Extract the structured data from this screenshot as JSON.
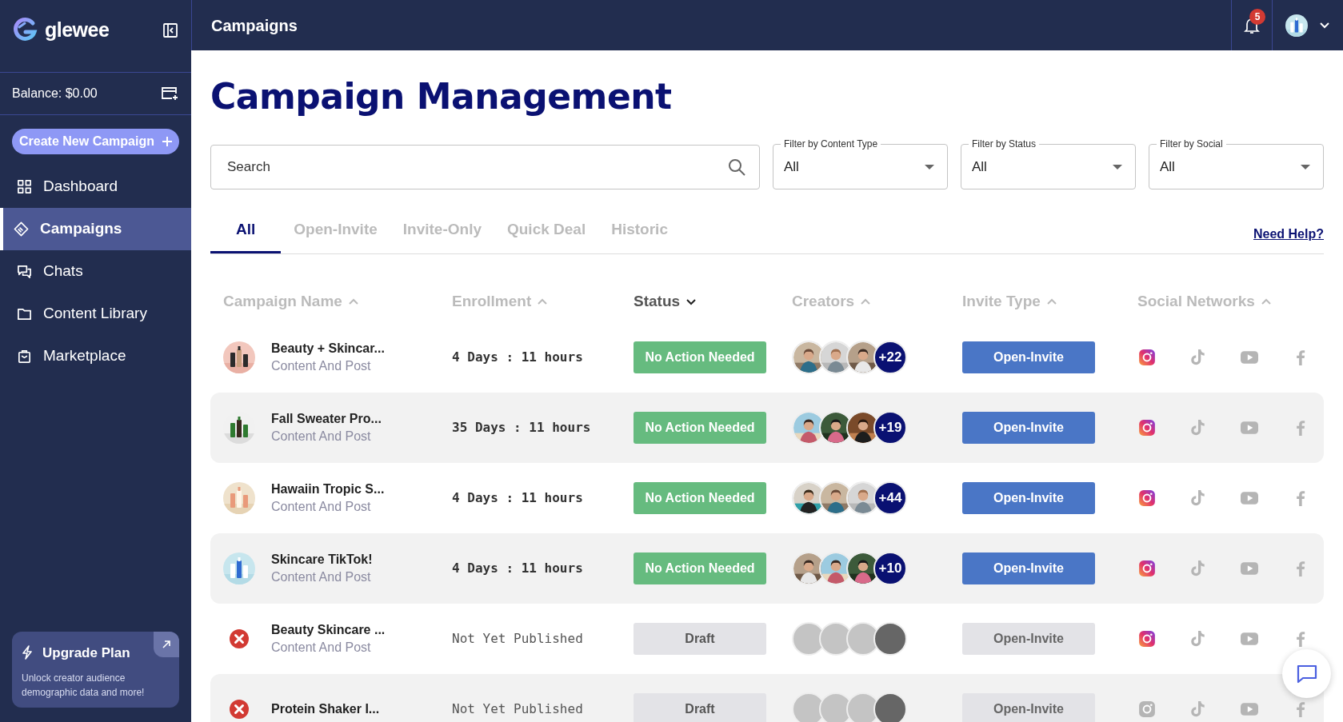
{
  "sidebar": {
    "logo": "glewee",
    "balance": "Balance: $0.00",
    "create_button": "Create New Campaign",
    "items": [
      {
        "label": "Dashboard",
        "selected": false
      },
      {
        "label": "Campaigns",
        "selected": true
      },
      {
        "label": "Chats",
        "selected": false
      },
      {
        "label": "Content Library",
        "selected": false
      },
      {
        "label": "Marketplace",
        "selected": false
      }
    ],
    "upgrade": {
      "title": "Upgrade Plan",
      "text": "Unlock creator audience demographic data and more!"
    }
  },
  "topbar": {
    "title": "Campaigns",
    "notifications": "5"
  },
  "page_title": "Campaign Management",
  "search": {
    "placeholder": "Search"
  },
  "filters": [
    {
      "label": "Filter by Content Type",
      "value": "All"
    },
    {
      "label": "Filter by Status",
      "value": "All"
    },
    {
      "label": "Filter by Social",
      "value": "All"
    }
  ],
  "tabs": [
    {
      "label": "All",
      "selected": true
    },
    {
      "label": "Open-Invite",
      "selected": false
    },
    {
      "label": "Invite-Only",
      "selected": false
    },
    {
      "label": "Quick Deal",
      "selected": false
    },
    {
      "label": "Historic",
      "selected": false
    }
  ],
  "help_link": "Need Help?",
  "columns": [
    {
      "label": "Campaign Name",
      "descending": false,
      "active": false
    },
    {
      "label": "Enrollment",
      "descending": false,
      "active": false
    },
    {
      "label": "Status",
      "descending": true,
      "active": true
    },
    {
      "label": "Creators",
      "descending": false,
      "active": false
    },
    {
      "label": "Invite Type",
      "descending": false,
      "active": false
    },
    {
      "label": "Social Networks",
      "descending": false,
      "active": false
    }
  ],
  "rows": [
    {
      "error": false,
      "name": "Beauty + Skincar...",
      "type": "Content And Post",
      "enrollment": "4 Days : 11 hours",
      "status": {
        "label": "No Action Needed",
        "kind": "ok"
      },
      "creators": {
        "kind": "avatars",
        "count": "+22"
      },
      "invite": {
        "label": "Open-Invite",
        "disabled": false
      },
      "socials": [
        {
          "active": true
        },
        {
          "active": false
        },
        {
          "active": false
        },
        {
          "active": false
        }
      ]
    },
    {
      "error": false,
      "name": "Fall Sweater Pro...",
      "type": "Content And Post",
      "enrollment": "35 Days : 11 hours",
      "status": {
        "label": "No Action Needed",
        "kind": "ok"
      },
      "creators": {
        "kind": "avatars",
        "count": "+19"
      },
      "invite": {
        "label": "Open-Invite",
        "disabled": false
      },
      "socials": [
        {
          "active": true
        },
        {
          "active": false
        },
        {
          "active": false
        },
        {
          "active": false
        }
      ]
    },
    {
      "error": false,
      "name": "Hawaiin Tropic S...",
      "type": "Content And Post",
      "enrollment": "4 Days : 11 hours",
      "status": {
        "label": "No Action Needed",
        "kind": "ok"
      },
      "creators": {
        "kind": "avatars",
        "count": "+44"
      },
      "invite": {
        "label": "Open-Invite",
        "disabled": false
      },
      "socials": [
        {
          "active": true
        },
        {
          "active": false
        },
        {
          "active": false
        },
        {
          "active": false
        }
      ]
    },
    {
      "error": false,
      "name": "Skincare TikTok!",
      "type": "Content And Post",
      "enrollment": "4 Days : 11 hours",
      "status": {
        "label": "No Action Needed",
        "kind": "ok"
      },
      "creators": {
        "kind": "avatars",
        "count": "+10"
      },
      "invite": {
        "label": "Open-Invite",
        "disabled": false
      },
      "socials": [
        {
          "active": true
        },
        {
          "active": false
        },
        {
          "active": false
        },
        {
          "active": false
        }
      ]
    },
    {
      "error": true,
      "name": "Beauty Skincare ...",
      "type": "Content And Post",
      "enrollment": "Not Yet Published",
      "status": {
        "label": "Draft",
        "kind": "draft"
      },
      "creators": {
        "kind": "placeholder"
      },
      "invite": {
        "label": "Open-Invite",
        "disabled": true
      },
      "socials": [
        {
          "active": true
        },
        {
          "active": false
        },
        {
          "active": false
        },
        {
          "active": false
        }
      ]
    },
    {
      "error": true,
      "name": "Protein Shaker I...",
      "enrollment": "Not Yet Published",
      "status": {
        "label": "Draft",
        "kind": "draft"
      },
      "creators": {
        "kind": "placeholder"
      },
      "invite": {
        "label": "Open-Invite",
        "disabled": true
      },
      "socials": [
        {
          "active": false
        },
        {
          "active": false
        },
        {
          "active": false
        },
        {
          "active": false
        }
      ]
    }
  ]
}
